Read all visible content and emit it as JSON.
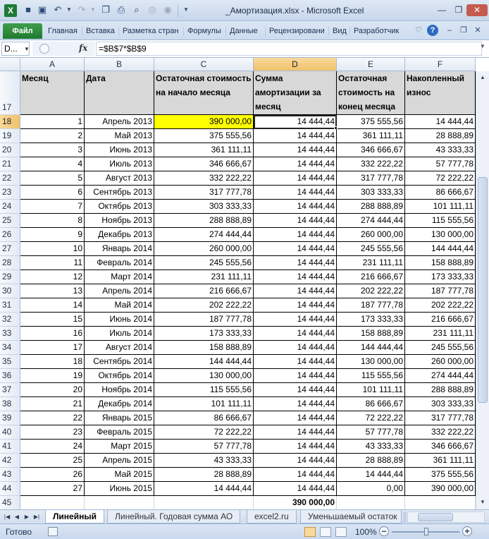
{
  "window": {
    "title": "_Амортизация.xlsx - Microsoft Excel",
    "app_logo": "X"
  },
  "qat": {
    "icons": [
      "save-icon",
      "save-as-icon",
      "undo-icon",
      "redo-icon",
      "copy-icon",
      "print-icon",
      "preview-icon",
      "camera-icon",
      "record-icon"
    ]
  },
  "ribbon": {
    "file_label": "Файл",
    "tabs": [
      "Главная",
      "Вставка",
      "Разметка стран",
      "Формулы",
      "Данные",
      "Рецензировани",
      "Вид",
      "Разработчик"
    ]
  },
  "formula_bar": {
    "name_box": "D...",
    "fx": "fx",
    "formula": "=$B$7*$B$9"
  },
  "grid": {
    "columns": [
      "A",
      "B",
      "C",
      "D",
      "E",
      "F"
    ],
    "active_column": "D",
    "header_row_number": "17",
    "headers": [
      "Месяц",
      "Дата",
      "Остаточная стоимость на начало месяца",
      "Сумма амортизации за месяц",
      "Остаточная стоимость на конец месяца",
      "Накопленный износ"
    ],
    "active_row": "18",
    "rows": [
      {
        "r": "18",
        "a": "1",
        "b": "Апрель 2013",
        "c": "390 000,00",
        "d": "14 444,44",
        "e": "375 555,56",
        "f": "14 444,44"
      },
      {
        "r": "19",
        "a": "2",
        "b": "Май 2013",
        "c": "375 555,56",
        "d": "14 444,44",
        "e": "361 111,11",
        "f": "28 888,89"
      },
      {
        "r": "20",
        "a": "3",
        "b": "Июнь 2013",
        "c": "361 111,11",
        "d": "14 444,44",
        "e": "346 666,67",
        "f": "43 333,33"
      },
      {
        "r": "21",
        "a": "4",
        "b": "Июль 2013",
        "c": "346 666,67",
        "d": "14 444,44",
        "e": "332 222,22",
        "f": "57 777,78"
      },
      {
        "r": "22",
        "a": "5",
        "b": "Август 2013",
        "c": "332 222,22",
        "d": "14 444,44",
        "e": "317 777,78",
        "f": "72 222,22"
      },
      {
        "r": "23",
        "a": "6",
        "b": "Сентябрь 2013",
        "c": "317 777,78",
        "d": "14 444,44",
        "e": "303 333,33",
        "f": "86 666,67"
      },
      {
        "r": "24",
        "a": "7",
        "b": "Октябрь 2013",
        "c": "303 333,33",
        "d": "14 444,44",
        "e": "288 888,89",
        "f": "101 111,11"
      },
      {
        "r": "25",
        "a": "8",
        "b": "Ноябрь 2013",
        "c": "288 888,89",
        "d": "14 444,44",
        "e": "274 444,44",
        "f": "115 555,56"
      },
      {
        "r": "26",
        "a": "9",
        "b": "Декабрь 2013",
        "c": "274 444,44",
        "d": "14 444,44",
        "e": "260 000,00",
        "f": "130 000,00"
      },
      {
        "r": "27",
        "a": "10",
        "b": "Январь 2014",
        "c": "260 000,00",
        "d": "14 444,44",
        "e": "245 555,56",
        "f": "144 444,44"
      },
      {
        "r": "28",
        "a": "11",
        "b": "Февраль 2014",
        "c": "245 555,56",
        "d": "14 444,44",
        "e": "231 111,11",
        "f": "158 888,89"
      },
      {
        "r": "29",
        "a": "12",
        "b": "Март 2014",
        "c": "231 111,11",
        "d": "14 444,44",
        "e": "216 666,67",
        "f": "173 333,33"
      },
      {
        "r": "30",
        "a": "13",
        "b": "Апрель 2014",
        "c": "216 666,67",
        "d": "14 444,44",
        "e": "202 222,22",
        "f": "187 777,78"
      },
      {
        "r": "31",
        "a": "14",
        "b": "Май 2014",
        "c": "202 222,22",
        "d": "14 444,44",
        "e": "187 777,78",
        "f": "202 222,22"
      },
      {
        "r": "32",
        "a": "15",
        "b": "Июнь 2014",
        "c": "187 777,78",
        "d": "14 444,44",
        "e": "173 333,33",
        "f": "216 666,67"
      },
      {
        "r": "33",
        "a": "16",
        "b": "Июль 2014",
        "c": "173 333,33",
        "d": "14 444,44",
        "e": "158 888,89",
        "f": "231 111,11"
      },
      {
        "r": "34",
        "a": "17",
        "b": "Август 2014",
        "c": "158 888,89",
        "d": "14 444,44",
        "e": "144 444,44",
        "f": "245 555,56"
      },
      {
        "r": "35",
        "a": "18",
        "b": "Сентябрь 2014",
        "c": "144 444,44",
        "d": "14 444,44",
        "e": "130 000,00",
        "f": "260 000,00"
      },
      {
        "r": "36",
        "a": "19",
        "b": "Октябрь 2014",
        "c": "130 000,00",
        "d": "14 444,44",
        "e": "115 555,56",
        "f": "274 444,44"
      },
      {
        "r": "37",
        "a": "20",
        "b": "Ноябрь 2014",
        "c": "115 555,56",
        "d": "14 444,44",
        "e": "101 111,11",
        "f": "288 888,89"
      },
      {
        "r": "38",
        "a": "21",
        "b": "Декабрь 2014",
        "c": "101 111,11",
        "d": "14 444,44",
        "e": "86 666,67",
        "f": "303 333,33"
      },
      {
        "r": "39",
        "a": "22",
        "b": "Январь 2015",
        "c": "86 666,67",
        "d": "14 444,44",
        "e": "72 222,22",
        "f": "317 777,78"
      },
      {
        "r": "40",
        "a": "23",
        "b": "Февраль 2015",
        "c": "72 222,22",
        "d": "14 444,44",
        "e": "57 777,78",
        "f": "332 222,22"
      },
      {
        "r": "41",
        "a": "24",
        "b": "Март 2015",
        "c": "57 777,78",
        "d": "14 444,44",
        "e": "43 333,33",
        "f": "346 666,67"
      },
      {
        "r": "42",
        "a": "25",
        "b": "Апрель 2015",
        "c": "43 333,33",
        "d": "14 444,44",
        "e": "28 888,89",
        "f": "361 111,11"
      },
      {
        "r": "43",
        "a": "26",
        "b": "Май 2015",
        "c": "28 888,89",
        "d": "14 444,44",
        "e": "14 444,44",
        "f": "375 555,56"
      },
      {
        "r": "44",
        "a": "27",
        "b": "Июнь 2015",
        "c": "14 444,44",
        "d": "14 444,44",
        "e": "0,00",
        "f": "390 000,00"
      }
    ],
    "total_row": {
      "r": "45",
      "d": "390 000,00"
    }
  },
  "sheets": {
    "tabs": [
      "Линейный",
      "Линейный. Годовая сумма АО",
      "excel2.ru",
      "Уменьшаемый остаток"
    ],
    "active": "Линейный"
  },
  "status": {
    "ready": "Готово",
    "zoom": "100%"
  },
  "colors": {
    "highlight": "#ffff00",
    "header_fill": "#d8d8d8",
    "file_tab": "#1f7a2f"
  }
}
